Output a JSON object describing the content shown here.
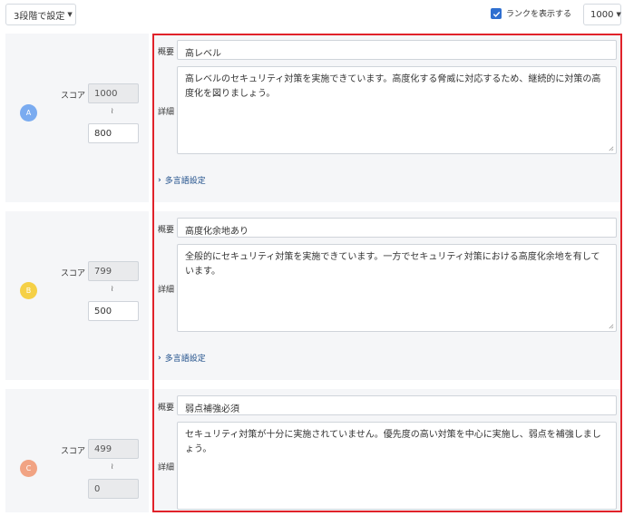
{
  "toolbar": {
    "level_label": "3段階で設定",
    "show_rank_label": "ランクを表示する",
    "show_rank_checked": true,
    "max_score": "1000",
    "accent_color": "#2f6fd0"
  },
  "labels": {
    "score": "スコア",
    "tilde": "≀",
    "summary": "概要",
    "detail": "詳細",
    "multilang": "多言語設定"
  },
  "ranks": [
    {
      "letter": "A",
      "color": "#7aabf0",
      "score_max": "1000",
      "score_min": "800",
      "summary": "高レベル",
      "detail": "高レベルのセキュリティ対策を実施できています。高度化する脅威に対応するため、継続的に対策の高度化を図りましょう。"
    },
    {
      "letter": "B",
      "color": "#f5d046",
      "score_max": "799",
      "score_min": "500",
      "summary": "高度化余地あり",
      "detail": "全般的にセキュリティ対策を実施できています。一方でセキュリティ対策における高度化余地を有しています。"
    },
    {
      "letter": "C",
      "color": "#f1a383",
      "score_max": "499",
      "score_min": "0",
      "summary": "弱点補強必須",
      "detail": "セキュリティ対策が十分に実施されていません。優先度の高い対策を中心に実施し、弱点を補強しましょう。"
    }
  ],
  "highlight_color": "#e0222a"
}
